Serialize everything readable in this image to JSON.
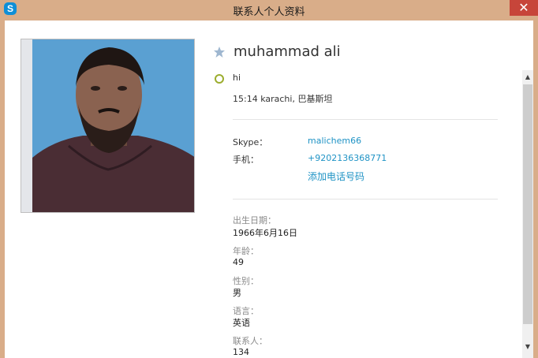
{
  "window": {
    "title": "联系人个人资料",
    "app_icon_letter": "S",
    "close_glyph": "✕"
  },
  "colors": {
    "window_frame": "#d9ad89",
    "close_button": "#c7453a",
    "link": "#1f93c5",
    "status_ring": "#9cad2e",
    "star": "#9fb7d0"
  },
  "profile": {
    "name": "muhammad  ali",
    "mood": "hi",
    "local_time_location": "15:14 karachi, 巴基斯坦",
    "favorite_icon": "star-icon",
    "presence_icon": "status-ring-icon"
  },
  "contact": {
    "skype_label": "Skype：",
    "skype_value": "malichem66",
    "mobile_label": "手机：",
    "mobile_value": "+9202136368771",
    "add_phone_label": "添加电话号码"
  },
  "details": [
    {
      "label": "出生日期：",
      "value": "1966年6月16日"
    },
    {
      "label": "年龄：",
      "value": "49"
    },
    {
      "label": "性别：",
      "value": "男"
    },
    {
      "label": "语言：",
      "value": "英语"
    },
    {
      "label": "联系人：",
      "value": "134"
    }
  ],
  "scrollbar": {
    "up_glyph": "▲",
    "down_glyph": "▼"
  }
}
